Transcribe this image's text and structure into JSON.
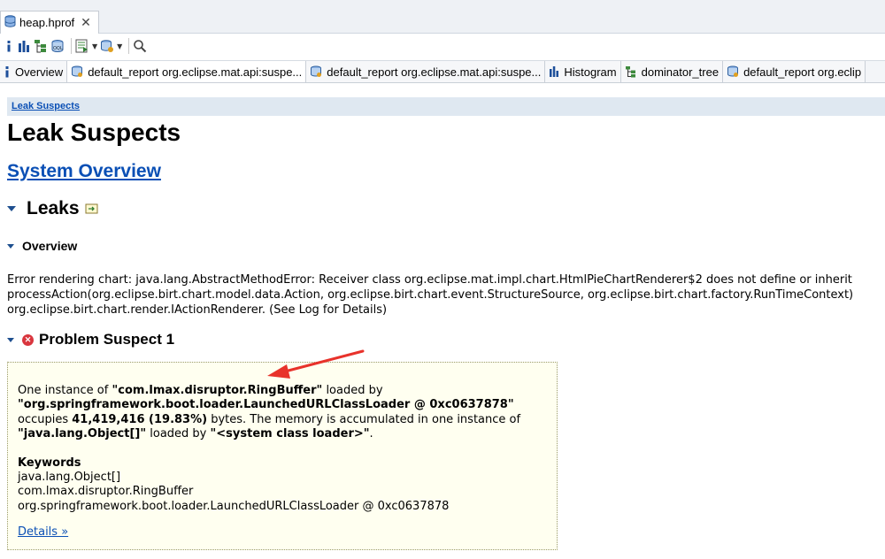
{
  "file_tab": {
    "label": "heap.hprof",
    "close": "✕"
  },
  "editor_tabs": [
    {
      "label": "Overview",
      "icon": "info-icon"
    },
    {
      "label": "default_report  org.eclipse.mat.api:suspe...",
      "icon": "report-icon"
    },
    {
      "label": "default_report  org.eclipse.mat.api:suspe...",
      "icon": "report-icon"
    },
    {
      "label": "Histogram",
      "icon": "histogram-icon"
    },
    {
      "label": "dominator_tree",
      "icon": "tree-icon"
    },
    {
      "label": "default_report  org.eclip",
      "icon": "report-icon"
    }
  ],
  "breadcrumb": "Leak Suspects",
  "page_title": "Leak Suspects",
  "system_overview_link": "System Overview",
  "leaks_heading": "Leaks",
  "overview_heading": "Overview",
  "error_lines": [
    "Error rendering chart: java.lang.AbstractMethodError: Receiver class org.eclipse.mat.impl.chart.HtmlPieChartRenderer$2 does not define or inherit",
    "processAction(org.eclipse.birt.chart.model.data.Action, org.eclipse.birt.chart.event.StructureSource, org.eclipse.birt.chart.factory.RunTimeContext)",
    "org.eclipse.birt.chart.render.IActionRenderer. (See Log for Details)"
  ],
  "suspect_heading": "Problem Suspect 1",
  "suspect": {
    "t1": "One instance of ",
    "class_name": "\"com.lmax.disruptor.RingBuffer\"",
    "t2": " loaded by",
    "loader": "\"org.springframework.boot.loader.LaunchedURLClassLoader @ 0xc0637878\"",
    "t3": "occupies ",
    "size": "41,419,416 (19.83%)",
    "t4": " bytes. The memory is accumulated in one instance of",
    "array": "\"java.lang.Object[]\"",
    "t5": " loaded by ",
    "sysloader": "\"<system class loader>\"",
    "t6": ".",
    "keywords_label": "Keywords",
    "keywords": [
      "java.lang.Object[]",
      "com.lmax.disruptor.RingBuffer",
      "org.springframework.boot.loader.LaunchedURLClassLoader @ 0xc0637878"
    ],
    "details_link": "Details »"
  },
  "colors": {
    "link": "#0a4fb5",
    "suspect_bg": "#fffff0",
    "annotation_arrow": "#e8322b",
    "breadcrumb_bg": "#dfe8f1"
  }
}
